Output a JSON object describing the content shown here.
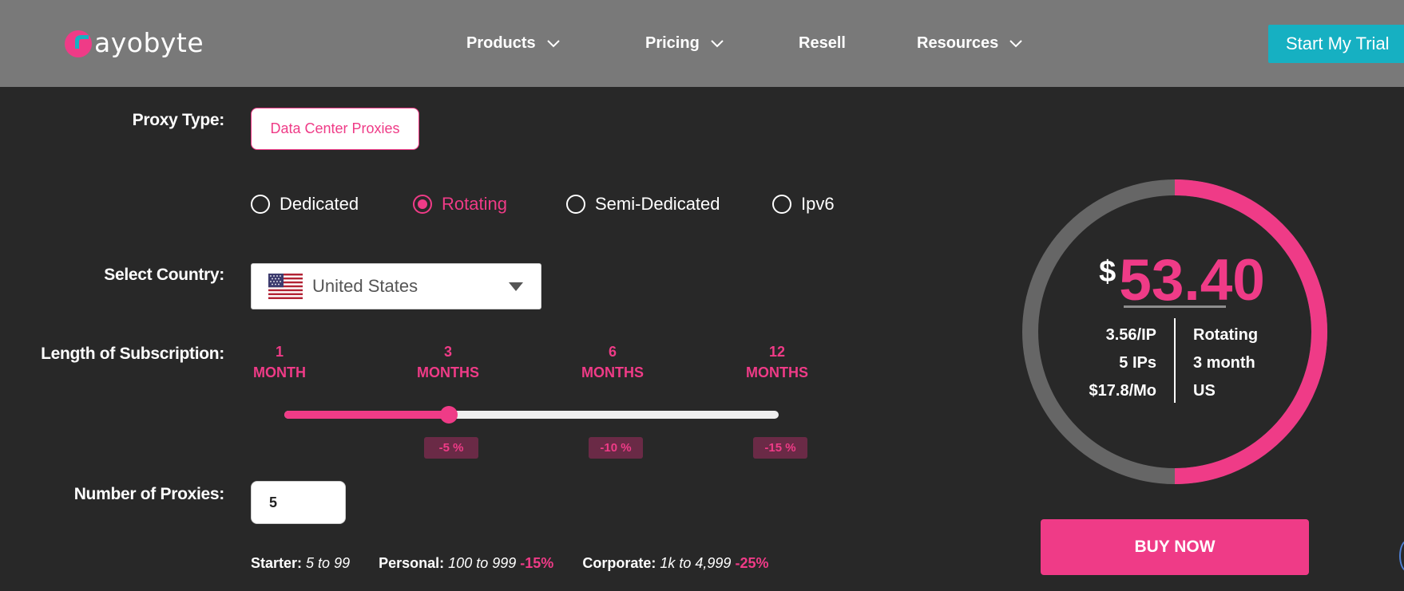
{
  "header": {
    "logo_text": "ayobyte",
    "nav": [
      {
        "label": "Products",
        "has_dropdown": true
      },
      {
        "label": "Pricing",
        "has_dropdown": true
      },
      {
        "label": "Resell",
        "has_dropdown": false
      },
      {
        "label": "Resources",
        "has_dropdown": true
      }
    ],
    "trial_button": "Start My Trial"
  },
  "form": {
    "proxy_type_label": "Proxy Type:",
    "proxy_type_value": "Data Center Proxies",
    "variants": [
      {
        "label": "Dedicated",
        "selected": false
      },
      {
        "label": "Rotating",
        "selected": true
      },
      {
        "label": "Semi-Dedicated",
        "selected": false
      },
      {
        "label": "Ipv6",
        "selected": false
      }
    ],
    "country_label": "Select Country:",
    "country_value": "United States",
    "subscription_label": "Length of Subscription:",
    "months": [
      {
        "num": "1",
        "unit": "MONTH"
      },
      {
        "num": "3",
        "unit": "MONTHS"
      },
      {
        "num": "6",
        "unit": "MONTHS"
      },
      {
        "num": "12",
        "unit": "MONTHS"
      }
    ],
    "slider_selected_index": 1,
    "slider_fraction": 0.333,
    "discounts": [
      "-5 %",
      "-10 %",
      "-15 %"
    ],
    "proxies_label": "Number of Proxies:",
    "proxies_value": "5",
    "tiers": [
      {
        "name": "Starter:",
        "range": "5 to 99",
        "discount": ""
      },
      {
        "name": "Personal:",
        "range": "100 to 999",
        "discount": "-15%"
      },
      {
        "name": "Corporate:",
        "range": "1k to 4,999",
        "discount": "-25%"
      }
    ]
  },
  "summary": {
    "currency": "$",
    "price": "53.40",
    "ring_fraction": 0.5,
    "per_ip": "3.56/IP",
    "ips": "5 IPs",
    "monthly": "$17.8/Mo",
    "type": "Rotating",
    "term": "3 month",
    "country": "US",
    "buy_button": "BUY NOW"
  },
  "colors": {
    "accent": "#ef3b87",
    "header_bg": "#797979",
    "page_bg": "#282828",
    "trial_button": "#16b0c2"
  }
}
